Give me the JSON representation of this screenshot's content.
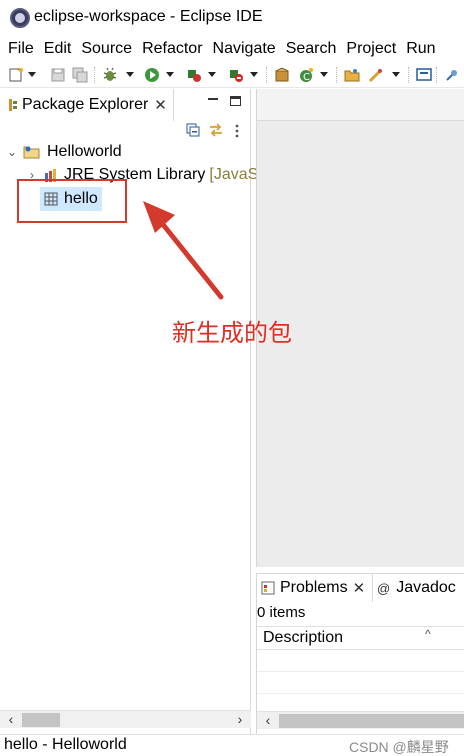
{
  "window": {
    "title": "eclipse-workspace - Eclipse IDE"
  },
  "menu": [
    "File",
    "Edit",
    "Source",
    "Refactor",
    "Navigate",
    "Search",
    "Project",
    "Run"
  ],
  "toolbar": {
    "icons": [
      "new-icon",
      "save-icon",
      "save-all-icon",
      "debug-icon",
      "run-icon",
      "coverage-icon",
      "external-tools-icon",
      "new-java-package-icon",
      "new-java-class-icon",
      "open-type-icon",
      "search-icon",
      "console-icon",
      "pin-icon"
    ]
  },
  "package_explorer": {
    "tab_label": "Package Explorer",
    "close_symbol": "✕",
    "tree": {
      "project": {
        "label": "Helloworld",
        "expanded": true
      },
      "library": {
        "label": "JRE System Library",
        "extra": "[JavaSE"
      },
      "package": {
        "label": "hello",
        "selected": true
      }
    }
  },
  "annotation": {
    "text": "新生成的包",
    "color": "#e02e24"
  },
  "bottom_panel": {
    "tabs": [
      {
        "label": "Problems",
        "close_symbol": "✕",
        "active": true
      },
      {
        "label": "Javadoc",
        "active": false
      }
    ],
    "items_count": "0 items",
    "column_header": "Description"
  },
  "statusbar": {
    "text": "hello - Helloworld",
    "watermark": "CSDN @麟星野"
  }
}
